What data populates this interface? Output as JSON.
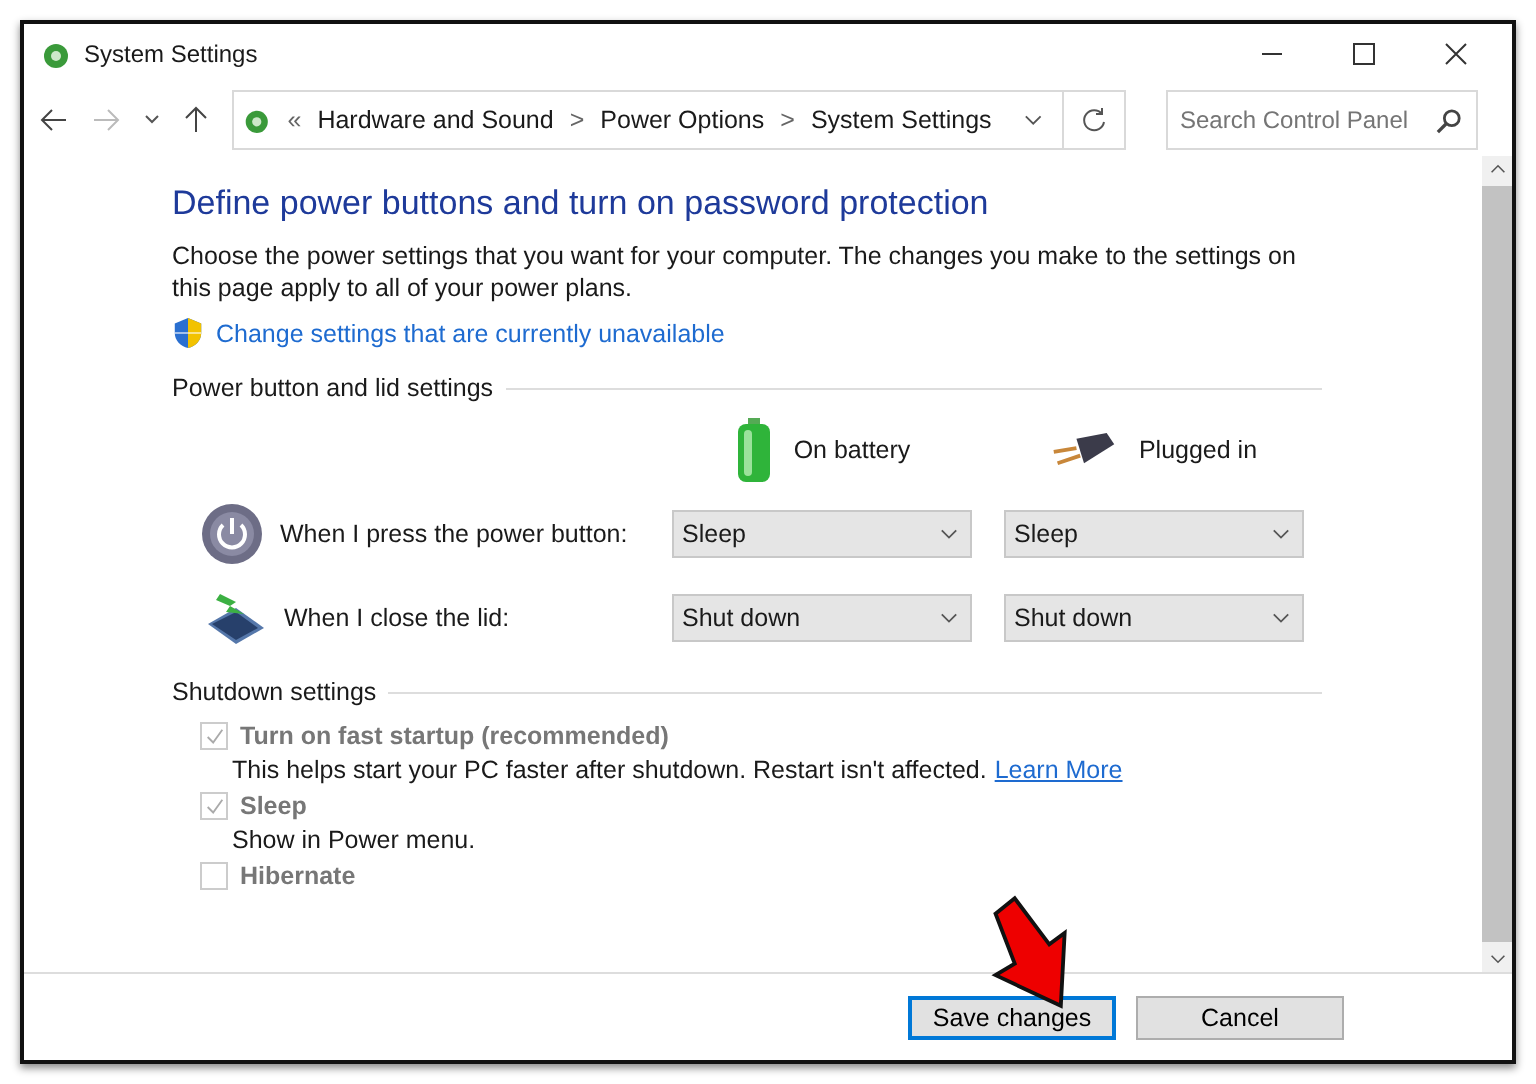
{
  "window": {
    "title": "System Settings"
  },
  "address_bar": {
    "crumbs": [
      "Hardware and Sound",
      "Power Options",
      "System Settings"
    ],
    "separator": ">",
    "overflow": "«"
  },
  "search": {
    "placeholder": "Search Control Panel"
  },
  "heading": "Define power buttons and turn on password protection",
  "intro": "Choose the power settings that you want for your computer. The changes you make to the settings on this page apply to all of your power plans.",
  "change_link": "Change settings that are currently unavailable",
  "power_section": {
    "title": "Power button and lid settings",
    "columns": [
      {
        "label": "On battery",
        "kind": "battery"
      },
      {
        "label": "Plugged in",
        "kind": "plug"
      }
    ],
    "rows": [
      {
        "label": "When I press the power button:",
        "kind": "power",
        "values": [
          "Sleep",
          "Sleep"
        ]
      },
      {
        "label": "When I close the lid:",
        "kind": "lid",
        "values": [
          "Shut down",
          "Shut down"
        ]
      }
    ]
  },
  "shutdown_section": {
    "title": "Shutdown settings",
    "options": [
      {
        "label": "Turn on fast startup (recommended)",
        "checked": true,
        "disabled": true,
        "description": "This helps start your PC faster after shutdown. Restart isn't affected.",
        "link": "Learn More"
      },
      {
        "label": "Sleep",
        "checked": true,
        "disabled": true,
        "description": "Show in Power menu."
      },
      {
        "label": "Hibernate",
        "checked": false,
        "disabled": true
      }
    ]
  },
  "buttons": [
    {
      "label": "Save changes",
      "selected": true
    },
    {
      "label": "Cancel",
      "selected": false
    }
  ]
}
